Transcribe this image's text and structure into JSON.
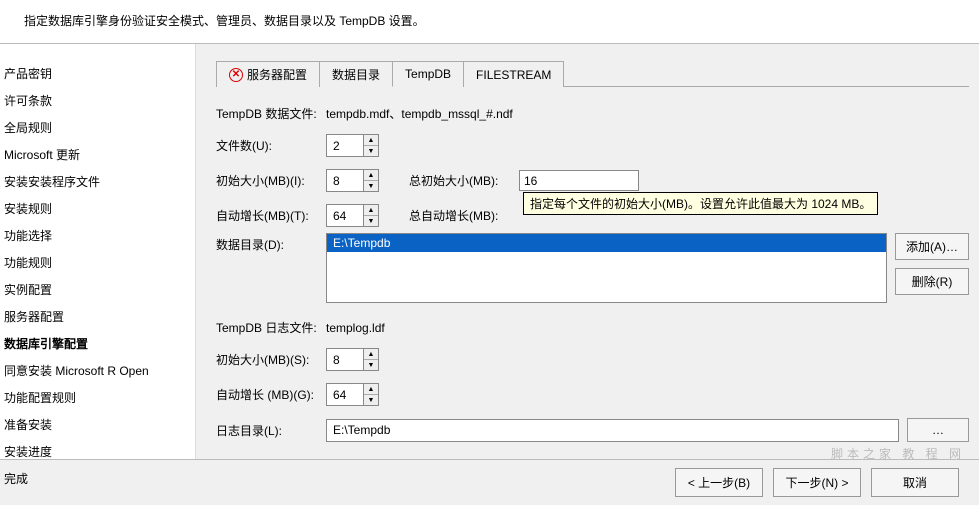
{
  "header": {
    "title": "指定数据库引擎身份验证安全模式、管理员、数据目录以及 TempDB 设置。"
  },
  "sidebar": {
    "items": [
      {
        "label": "产品密钥"
      },
      {
        "label": "许可条款"
      },
      {
        "label": "全局规则"
      },
      {
        "label": "Microsoft 更新"
      },
      {
        "label": "安装安装程序文件"
      },
      {
        "label": "安装规则"
      },
      {
        "label": "功能选择"
      },
      {
        "label": "功能规则"
      },
      {
        "label": "实例配置"
      },
      {
        "label": "服务器配置"
      },
      {
        "label": "数据库引擎配置",
        "active": true
      },
      {
        "label": "同意安装 Microsoft R Open"
      },
      {
        "label": "功能配置规则"
      },
      {
        "label": "准备安装"
      },
      {
        "label": "安装进度"
      },
      {
        "label": "完成"
      }
    ]
  },
  "tabs": [
    {
      "label": "服务器配置",
      "icon": "error"
    },
    {
      "label": "数据目录"
    },
    {
      "label": "TempDB",
      "active": true
    },
    {
      "label": "FILESTREAM"
    }
  ],
  "tempdb": {
    "data_files_label": "TempDB 数据文件:",
    "data_files_value": "tempdb.mdf、tempdb_mssql_#.ndf",
    "file_count_label": "文件数(U):",
    "file_count_value": "2",
    "init_size_label": "初始大小(MB)(I):",
    "init_size_value": "8",
    "total_init_label": "总初始大小(MB):",
    "total_init_value": "16",
    "autogrow_label": "自动增长(MB)(T):",
    "autogrow_value": "64",
    "total_autogrow_label": "总自动增长(MB):",
    "data_dir_label": "数据目录(D):",
    "data_dir_value": "E:\\Tempdb",
    "add_btn": "添加(A)…",
    "remove_btn": "删除(R)",
    "log_files_label": "TempDB 日志文件:",
    "log_files_value": "templog.ldf",
    "log_init_label": "初始大小(MB)(S):",
    "log_init_value": "8",
    "log_autogrow_label": "自动增长 (MB)(G):",
    "log_autogrow_value": "64",
    "log_dir_label": "日志目录(L):",
    "log_dir_value": "E:\\Tempdb",
    "tooltip": "指定每个文件的初始大小(MB)。设置允许此值最大为 1024 MB。"
  },
  "footer": {
    "back": "< 上一步(B)",
    "next": "下一步(N) >",
    "cancel": "取消"
  },
  "watermark": "脚本之家 教 程 网"
}
